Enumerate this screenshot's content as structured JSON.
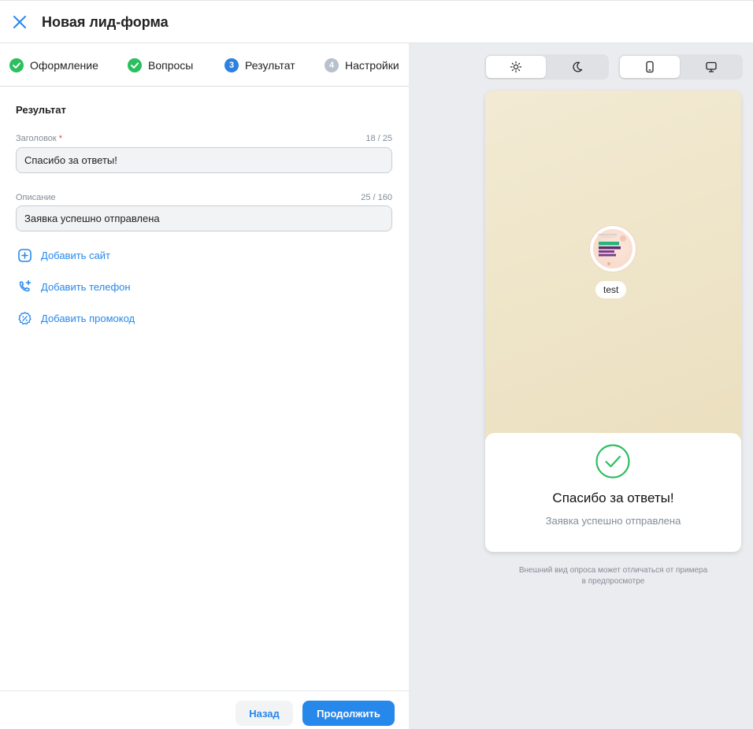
{
  "header": {
    "title": "Новая лид-форма"
  },
  "steps": [
    {
      "label": "Оформление",
      "badge": "",
      "state": "done"
    },
    {
      "label": "Вопросы",
      "badge": "",
      "state": "done"
    },
    {
      "label": "Результат",
      "badge": "3",
      "state": "active"
    },
    {
      "label": "Настройки",
      "badge": "4",
      "state": "todo"
    }
  ],
  "form": {
    "section_title": "Результат",
    "title_field": {
      "label": "Заголовок",
      "required_mark": "*",
      "counter": "18 / 25",
      "value": "Спасибо за ответы!"
    },
    "desc_field": {
      "label": "Описание",
      "counter": "25 / 160",
      "value": "Заявка успешно отправлена"
    },
    "links": {
      "add_site": "Добавить сайт",
      "add_phone": "Добавить телефон",
      "add_promo": "Добавить промокод"
    }
  },
  "footer": {
    "back": "Назад",
    "next": "Продолжить"
  },
  "preview": {
    "theme_options": [
      "sun-icon",
      "moon-icon"
    ],
    "theme_selected": "light",
    "device_options": [
      "phone-icon",
      "desktop-icon"
    ],
    "device_selected": "mobile",
    "brand_name": "test",
    "result_title": "Спасибо за ответы!",
    "result_desc": "Заявка успешно отправлена",
    "disclaimer": "Внешний вид опроса может отличаться от примера в предпросмотре"
  },
  "colors": {
    "accent": "#2688eb",
    "step_done": "#2dbe60",
    "step_active": "#2d81e0",
    "success": "#2dbe60",
    "required": "#e64646"
  }
}
